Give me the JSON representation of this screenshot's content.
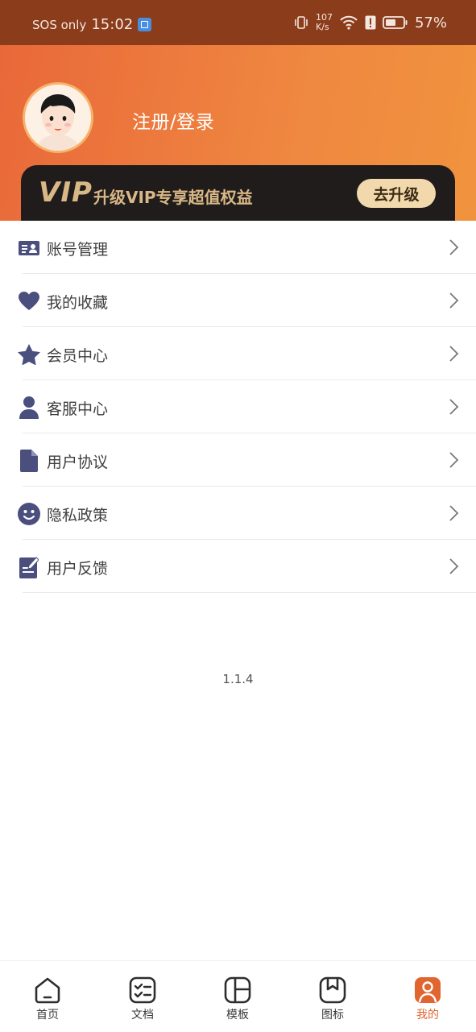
{
  "status_bar": {
    "sos": "SOS only",
    "time": "15:02",
    "speed_top": "107",
    "speed_bottom": "K/s",
    "battery": "57%"
  },
  "profile": {
    "login_label": "注册/登录"
  },
  "vip": {
    "logo": "VIP",
    "text": "升级VIP专享超值权益",
    "button": "去升级",
    "colors": {
      "card": "#201c1b",
      "gold": "#d9b887",
      "button": "#f1d9ad"
    }
  },
  "menu": {
    "items": [
      {
        "label": "账号管理",
        "icon": "id-card-icon"
      },
      {
        "label": "我的收藏",
        "icon": "heart-icon"
      },
      {
        "label": "会员中心",
        "icon": "star-icon"
      },
      {
        "label": "客服中心",
        "icon": "user-icon"
      },
      {
        "label": "用户协议",
        "icon": "document-icon"
      },
      {
        "label": "隐私政策",
        "icon": "smile-icon"
      },
      {
        "label": "用户反馈",
        "icon": "feedback-icon"
      }
    ]
  },
  "version": "1.1.4",
  "nav": {
    "items": [
      {
        "label": "首页",
        "icon": "home-icon"
      },
      {
        "label": "文档",
        "icon": "checklist-icon"
      },
      {
        "label": "模板",
        "icon": "template-icon"
      },
      {
        "label": "图标",
        "icon": "bookmark-icon"
      },
      {
        "label": "我的",
        "icon": "profile-icon",
        "active": true
      }
    ],
    "active_color": "#e0652e"
  },
  "colors": {
    "header_gradient_start": "#e9683a",
    "header_gradient_end": "#f0933e",
    "icon": "#4a4f7e"
  }
}
